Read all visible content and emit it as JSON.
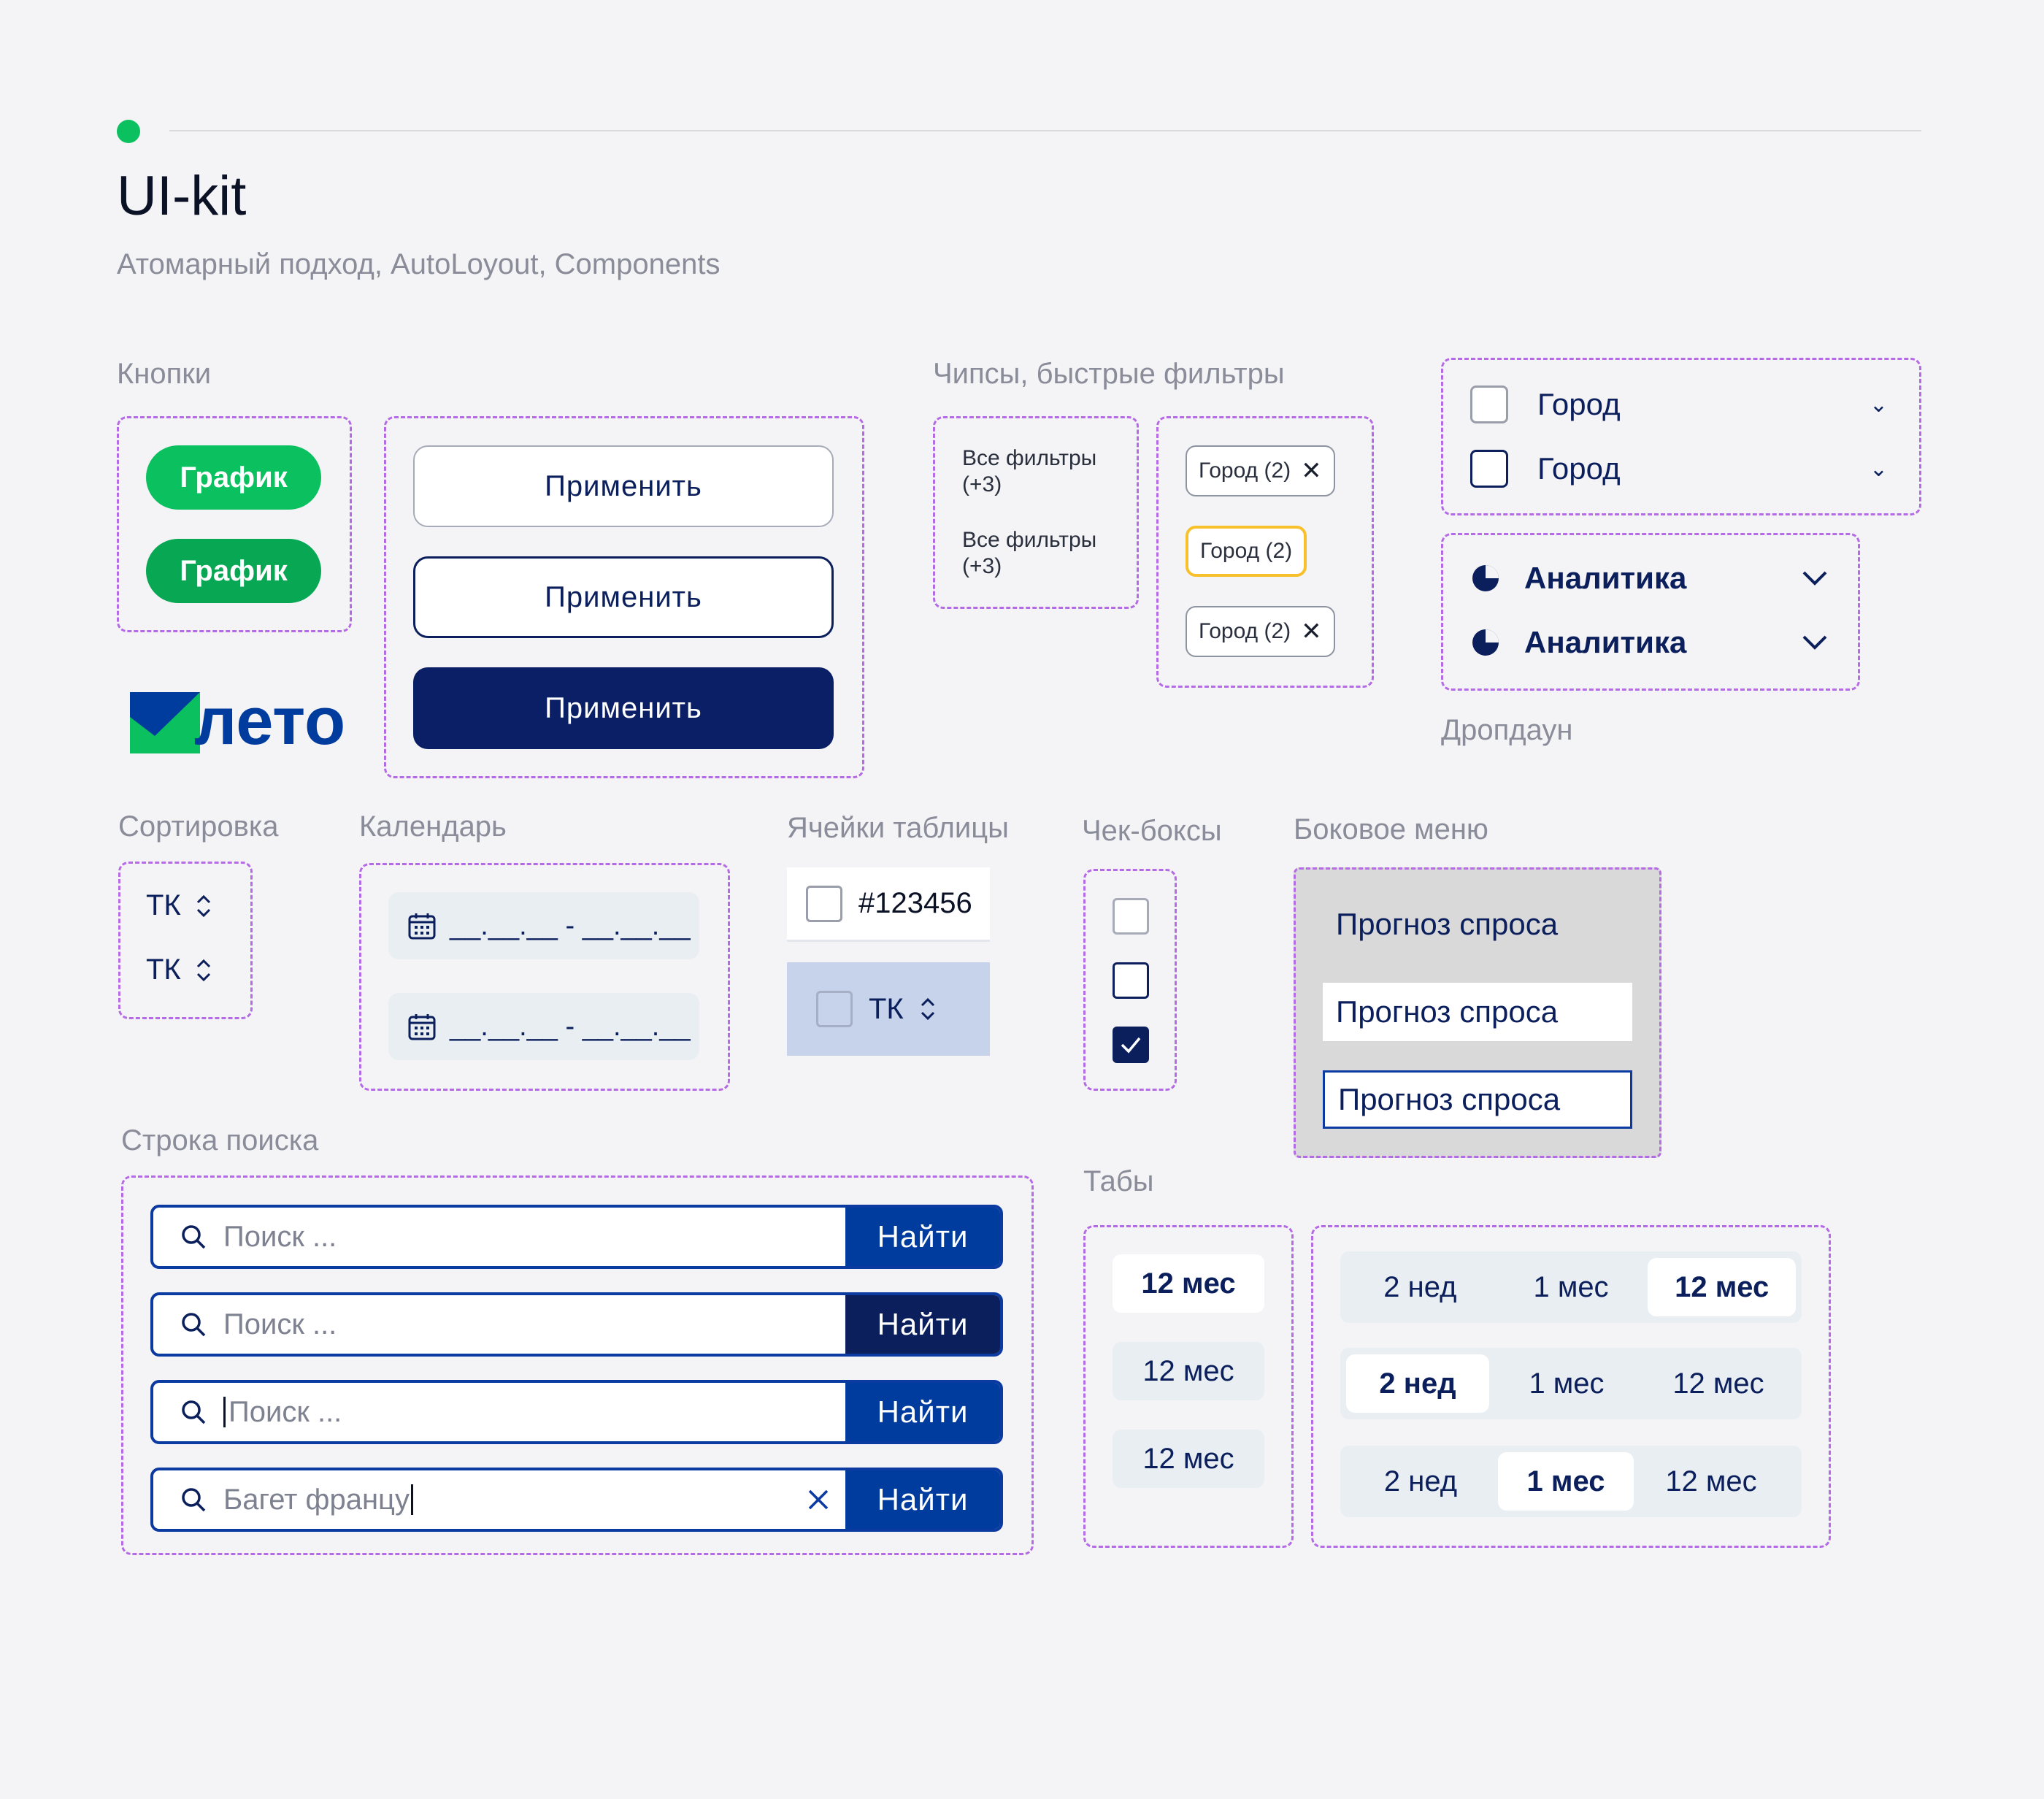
{
  "header": {
    "title": "UI-kit",
    "subtitle": "Атомарный подход, AutoLoyout, Components"
  },
  "sections": {
    "buttons": "Кнопки",
    "chips": "Чипсы, быстрые фильтры",
    "dropdown": "Дропдаун",
    "sort": "Сортировка",
    "calendar": "Календарь",
    "table_cells": "Ячейки таблицы",
    "checkboxes": "Чек-боксы",
    "side_menu": "Боковое меню",
    "search": "Строка поиска",
    "tabs": "Табы"
  },
  "buttons": {
    "green_label": "График",
    "apply_label": "Применить"
  },
  "logo": {
    "text": "лето",
    "brand_green": "#0ac05f",
    "brand_blue": "#003c9e"
  },
  "chips": {
    "all_filters": "Все фильтры (+3)",
    "city": "Город (2)"
  },
  "dropdown": {
    "city": "Город",
    "analytics": "Аналитика"
  },
  "sort": {
    "label": "ТК"
  },
  "calendar": {
    "placeholder": "__.__.__ - __.__.__"
  },
  "table_cells": {
    "id_value": "#123456",
    "sort_label": "ТК"
  },
  "side_menu": {
    "item": "Прогноз спроса"
  },
  "search": {
    "placeholder": "Поиск ...",
    "typed_value": "Багет францу",
    "button": "Найти"
  },
  "tabs": {
    "two_weeks": "2 нед",
    "one_month": "1 мес",
    "twelve_months": "12 мес"
  },
  "colors": {
    "accent_green": "#0ac05f",
    "navy": "#0b1f5c",
    "primary_blue": "#003c9e",
    "dash_purple": "#b56ae6",
    "chip_highlight": "#f8c12b"
  }
}
